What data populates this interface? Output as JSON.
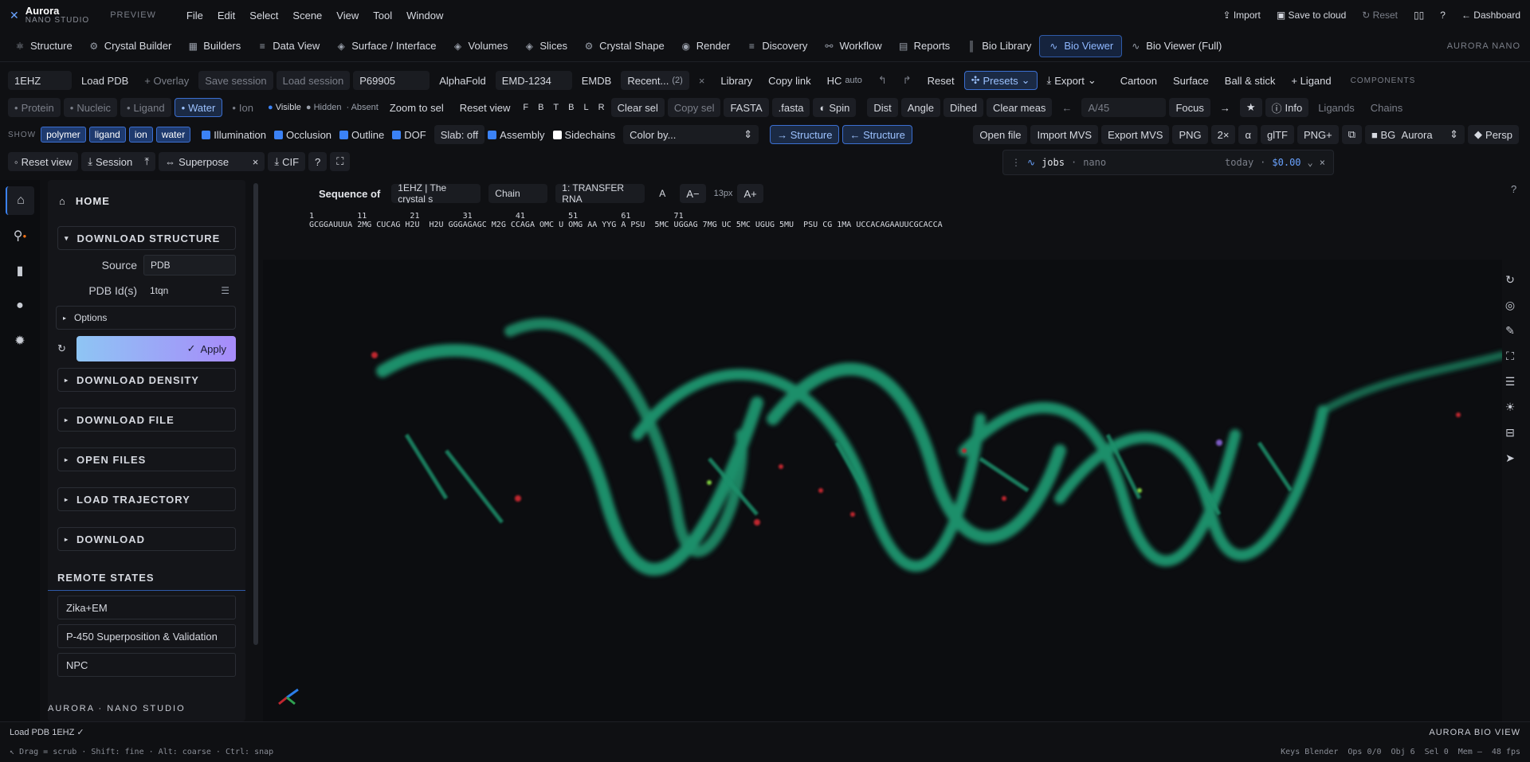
{
  "app": {
    "name": "Aurora",
    "subtitle": "NANO STUDIO",
    "preview": "PREVIEW"
  },
  "menu": [
    "File",
    "Edit",
    "Select",
    "Scene",
    "View",
    "Tool",
    "Window"
  ],
  "top_right": {
    "import": "Import",
    "save": "Save to cloud",
    "reset": "Reset",
    "help": "?",
    "dashboard": "Dashboard"
  },
  "tabs": [
    "Structure",
    "Crystal Builder",
    "Builders",
    "Data View",
    "Surface / Interface",
    "Volumes",
    "Slices",
    "Crystal Shape",
    "Render",
    "Discovery",
    "Workflow",
    "Reports",
    "Bio Library",
    "Bio Viewer",
    "Bio Viewer (Full)"
  ],
  "brand_right": "AURORA NANO",
  "toolbar1": {
    "pdb_id": "1EHZ",
    "load_pdb": "Load PDB",
    "overlay": "+ Overlay",
    "save_session": "Save session",
    "load_session": "Load session",
    "uniprot": "P69905",
    "alphafold": "AlphaFold",
    "emdb_id": "EMD-1234",
    "emdb": "EMDB",
    "recent": "Recent...",
    "recent_count": "(2)",
    "library": "Library",
    "copy_link": "Copy link",
    "hc": "HC",
    "hc_mode": "auto",
    "reset": "Reset",
    "presets": "Presets",
    "export": "Export",
    "cartoon": "Cartoon",
    "surface": "Surface",
    "ball_stick": "Ball & stick",
    "ligand": "+ Ligand",
    "components": "COMPONENTS"
  },
  "toolbar2": {
    "protein": "Protein",
    "nucleic": "Nucleic",
    "ligand": "Ligand",
    "water": "Water",
    "ion": "Ion",
    "visible": "Visible",
    "hidden": "Hidden",
    "absent": "Absent",
    "zoom_sel": "Zoom to sel",
    "reset_view": "Reset view",
    "letters": [
      "F",
      "B",
      "T",
      "B",
      "L",
      "R"
    ],
    "clear_sel": "Clear sel",
    "copy_sel": "Copy sel",
    "fasta": "FASTA",
    "fasta_ext": ".fasta",
    "spin": "Spin",
    "dist": "Dist",
    "angle": "Angle",
    "dihed": "Dihed",
    "clear_meas": "Clear meas",
    "residue": "A/45",
    "focus": "Focus",
    "info": "Info",
    "ligands": "Ligands",
    "chains": "Chains"
  },
  "toolbar3": {
    "show": "SHOW",
    "pills": [
      "polymer",
      "ligand",
      "ion",
      "water"
    ],
    "checks": [
      {
        "label": "Illumination",
        "on": true
      },
      {
        "label": "Occlusion",
        "on": true
      },
      {
        "label": "Outline",
        "on": true
      },
      {
        "label": "DOF",
        "on": true
      }
    ],
    "slab": "Slab: off",
    "assembly": "Assembly",
    "sidechains": "Sidechains",
    "color_by": "Color by...",
    "to_structure": "→ Structure",
    "from_structure": "← Structure",
    "open_file": "Open file",
    "import_mvs": "Import MVS",
    "export_mvs": "Export MVS",
    "png": "PNG",
    "x2": "2×",
    "alpha": "α",
    "gltf": "glTF",
    "png_plus": "PNG+",
    "bg": "BG",
    "bg_value": "Aurora",
    "persp": "Persp"
  },
  "toolbar4": {
    "reset_view": "Reset view",
    "session": "Session",
    "superpose": "Superpose",
    "cif": "CIF",
    "help": "?"
  },
  "jobs": {
    "label": "jobs",
    "sub": "nano",
    "date": "today",
    "cost": "$0.00"
  },
  "sidebar": {
    "home": "HOME",
    "download_structure": "DOWNLOAD STRUCTURE",
    "source_label": "Source",
    "source_value": "PDB",
    "pdb_label": "PDB Id(s)",
    "pdb_value": "1tqn",
    "options": "Options",
    "apply": "Apply",
    "sections": [
      "DOWNLOAD DENSITY",
      "DOWNLOAD FILE",
      "OPEN FILES",
      "LOAD TRAJECTORY",
      "DOWNLOAD"
    ],
    "remote_title": "REMOTE STATES",
    "remote_items": [
      "Zika+EM",
      "P-450 Superposition & Validation",
      "NPC"
    ]
  },
  "sequence": {
    "title": "Sequence of",
    "entity": "1EHZ | The crystal s",
    "chain_label": "Chain",
    "molecule": "1: TRANSFER RNA",
    "mode": "A",
    "font_size": "13px",
    "dec": "A−",
    "inc": "A+",
    "numbers": "1         11         21         31         41         51         61         71",
    "residues": "GCGGAUUUA 2MG CUCAG H2U  H2U GGGAGAGC M2G CCAGA OMC U OMG AA YYG A PSU  5MC UGGAG 7MG UC 5MC UGUG 5MU  PSU CG 1MA UCCACAGAAUUCGCACCA"
  },
  "status": {
    "left": "Load PDB 1EHZ ✓",
    "right": "AURORA BIO VIEW"
  },
  "hints": {
    "left": "Drag = scrub · Shift: fine · Alt: coarse · Ctrl: snap",
    "keys": "Keys Blender",
    "ops": "Ops 0/0",
    "obj": "Obj 6",
    "sel": "Sel 0",
    "mem": "Mem –",
    "fps": "48 fps"
  },
  "brand_foot": "AURORA · NANO STUDIO",
  "colors": {
    "accent": "#3b82f6",
    "rna": "#1f8f6a",
    "bg": "#0f1013"
  }
}
